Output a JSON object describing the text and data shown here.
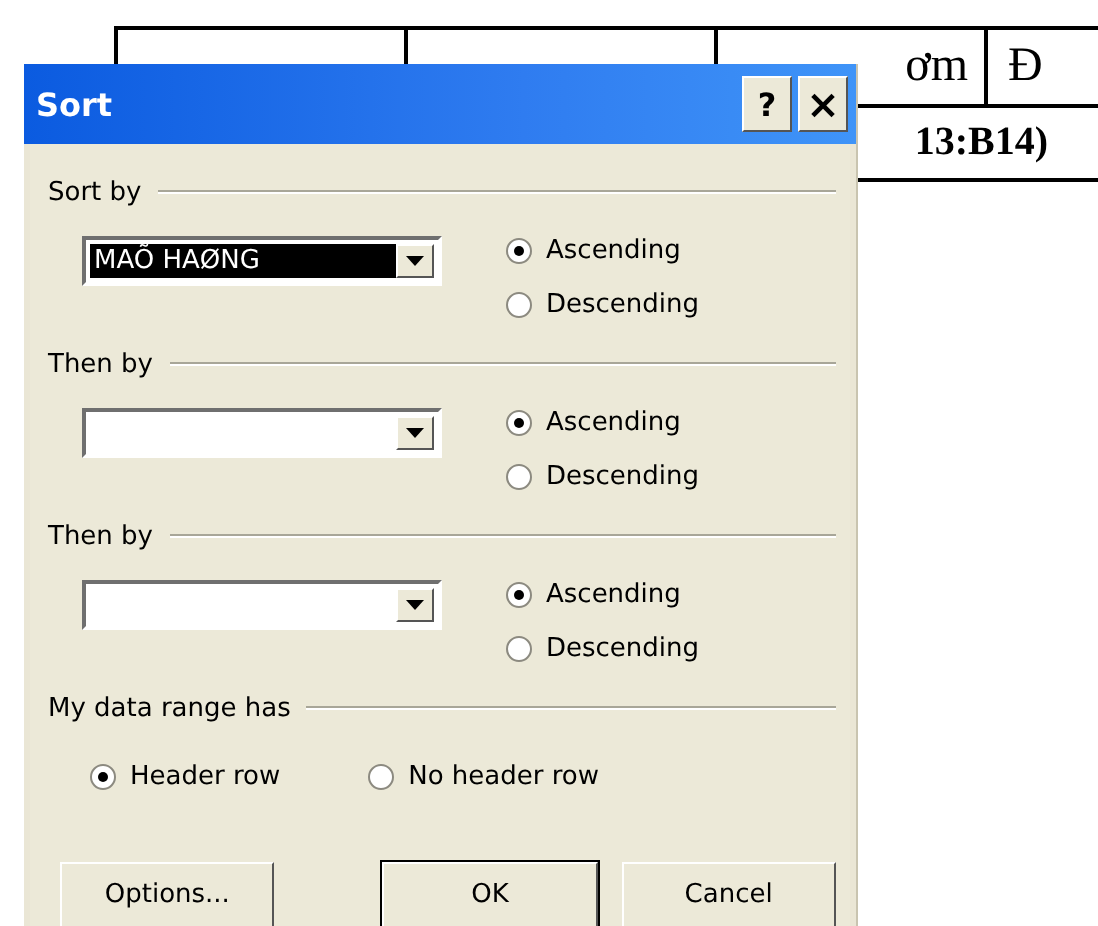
{
  "document": {
    "table_header": [
      "ơm",
      "Đ"
    ],
    "table_row": [
      "13:B14)"
    ]
  },
  "dialog": {
    "title": "Sort",
    "title_buttons": [
      {
        "kind": "help",
        "label": "?"
      },
      {
        "kind": "close",
        "label": "×"
      }
    ],
    "sort_keys": [
      {
        "label": "Sort by",
        "value": "MAÕ HAØNG",
        "highlighted": true,
        "options": [
          {
            "label": "Ascending",
            "selected": true
          },
          {
            "label": "Descending",
            "selected": false
          }
        ]
      },
      {
        "label": "Then by",
        "highlighted": false,
        "options": [
          {
            "label": "Ascending",
            "selected": true
          },
          {
            "label": "Descending",
            "selected": false
          }
        ]
      },
      {
        "label": "Then by",
        "highlighted": false,
        "options": [
          {
            "label": "Ascending",
            "selected": true
          },
          {
            "label": "Descending",
            "selected": false
          }
        ]
      }
    ],
    "header": {
      "label": "My data range has",
      "options": [
        {
          "label": "Header row",
          "selected": true
        },
        {
          "label": "No header row",
          "selected": false
        }
      ]
    },
    "buttons": [
      {
        "label": "Options...",
        "default": false
      },
      {
        "label": "OK",
        "default": true
      },
      {
        "label": "Cancel",
        "default": false
      }
    ]
  }
}
